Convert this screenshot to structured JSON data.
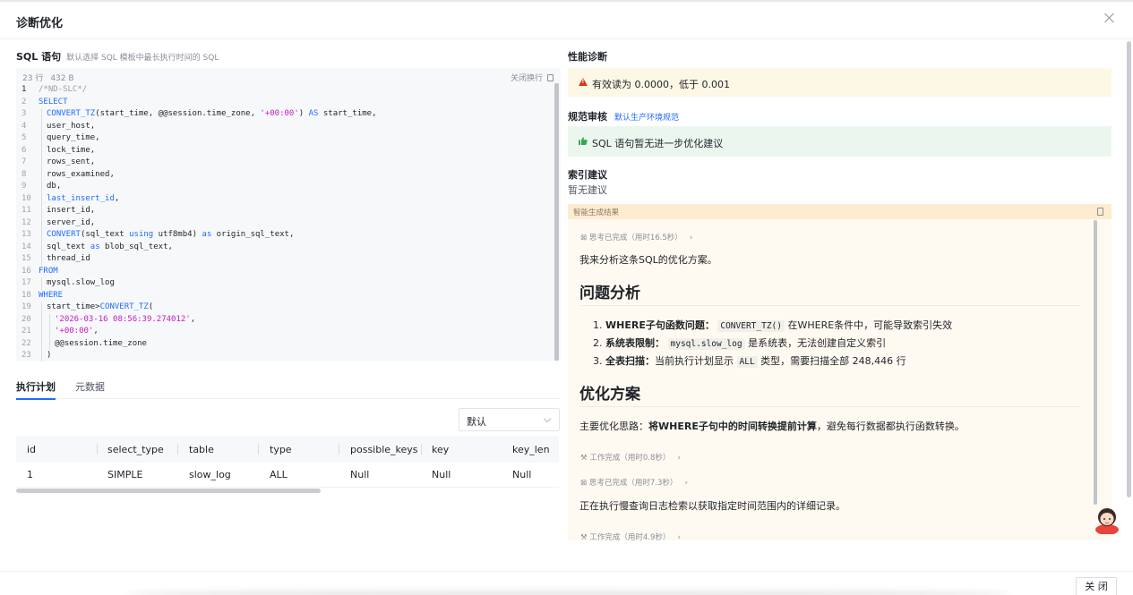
{
  "dialog": {
    "title": "诊断优化",
    "close_label": "关 闭"
  },
  "sql": {
    "title": "SQL 语句",
    "subtitle": "默认选择 SQL 模板中最长执行时间的 SQL",
    "line_count": "23 行",
    "size": "432 B",
    "wrap_label": "关闭换行"
  },
  "tabs": {
    "plan": "执行计划",
    "meta": "元数据"
  },
  "plan_select": {
    "value": "默认"
  },
  "plan_table": {
    "headers": [
      "id",
      "select_type",
      "table",
      "type",
      "possible_keys",
      "key",
      "key_len"
    ],
    "rows": [
      [
        "1",
        "SIMPLE",
        "slow_log",
        "ALL",
        "Null",
        "Null",
        "Null"
      ]
    ]
  },
  "perf": {
    "title": "性能诊断",
    "warning": "有效读为 0.0000，低于 0.001"
  },
  "review": {
    "title": "规范审核",
    "link": "默认生产环境规范",
    "ok_text": "SQL 语句暂无进一步优化建议"
  },
  "index": {
    "title": "索引建议",
    "none": "暂无建议"
  },
  "ai": {
    "label": "智能生成结果",
    "step1": "思考已完成（用时16.5秒）",
    "intro": "我来分析这条SQL的优化方案。",
    "h_problem": "问题分析",
    "p1_bold": "WHERE子句函数问题：",
    "p1_code": "CONVERT_TZ()",
    "p1_rest": "在WHERE条件中，可能导致索引失效",
    "p2_bold": "系统表限制：",
    "p2_code": "mysql.slow_log",
    "p2_rest": "是系统表，无法创建自定义索引",
    "p3_bold": "全表扫描：",
    "p3_pre": "当前执行计划显示",
    "p3_code": "ALL",
    "p3_rest": "类型，需要扫描全部 248,446 行",
    "h_opt": "优化方案",
    "opt_pre": "主要优化思路：",
    "opt_bold": "将WHERE子句中的时间转换提前计算",
    "opt_rest": "，避免每行数据都执行函数转换。",
    "step2": "工作完成（用时0.8秒）",
    "step3": "思考已完成（用时7.3秒）",
    "exec": "正在执行慢查询日志检索以获取指定时间范围内的详细记录。",
    "step4": "工作完成（用时4.9秒）"
  },
  "colors": {
    "accent": "#1f6bff",
    "warn_bg": "#fdf7e6",
    "ok_bg": "#ebf7ee",
    "ai_bg": "#fffaf1"
  },
  "icons": [
    "close-icon",
    "copy-icon",
    "warning-icon",
    "thumbs-up-icon",
    "chevron-down-icon",
    "wrench-icon",
    "thinking-icon",
    "assistant-avatar-icon"
  ]
}
